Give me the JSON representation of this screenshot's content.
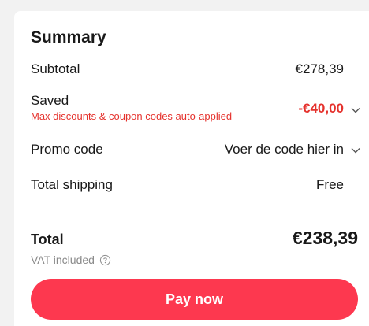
{
  "summary": {
    "title": "Summary",
    "subtotal_label": "Subtotal",
    "subtotal_value": "€278,39",
    "saved_label": "Saved",
    "saved_note": "Max discounts & coupon codes auto-applied",
    "saved_value": "-€40,00",
    "promo_label": "Promo code",
    "promo_placeholder": "Voer de code hier in",
    "shipping_label": "Total shipping",
    "shipping_value": "Free",
    "total_label": "Total",
    "total_value": "€238,39",
    "vat_label": "VAT included",
    "pay_button": "Pay now"
  },
  "colors": {
    "accent": "#fd384f",
    "discount": "#e5322d",
    "muted": "#8a8a8a"
  },
  "icons": {
    "saved_chevron": "chevron-down-icon",
    "promo_chevron": "chevron-down-icon",
    "vat_help": "question-circle-icon"
  }
}
